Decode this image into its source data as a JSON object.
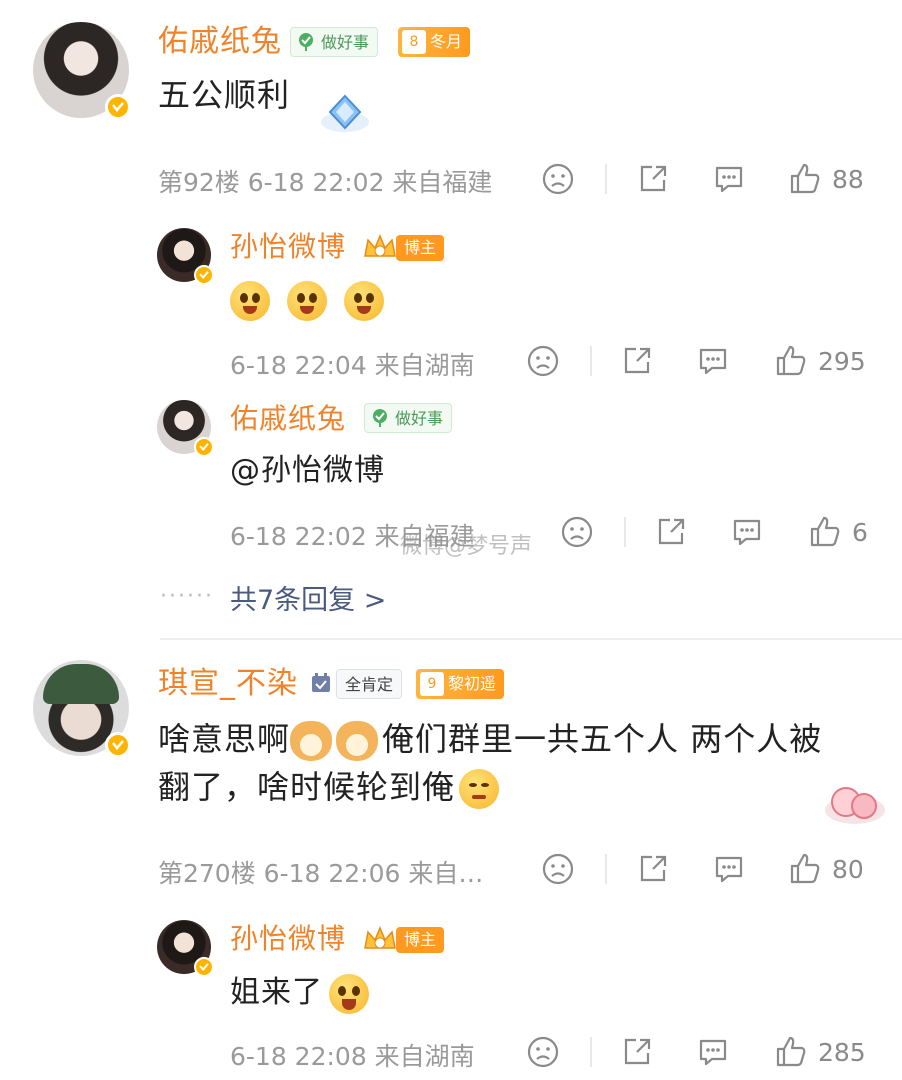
{
  "comments": [
    {
      "username": "佑戚纸兔",
      "badge_good": "做好事",
      "fan_level": "8",
      "fan_badge": "冬月",
      "text": "五公顺利",
      "meta": "第92楼  6-18 22:02  来自福建",
      "likes": "88",
      "replies": [
        {
          "username": "孙怡微博",
          "host_badge": "博主",
          "text_emojis": 3,
          "meta": "6-18 22:04  来自湖南",
          "likes": "295"
        },
        {
          "username": "佑戚纸兔",
          "badge_good": "做好事",
          "text": "@孙怡微博",
          "meta": "6-18 22:02  来自福建",
          "likes": "6"
        }
      ],
      "more_replies": "共7条回复 >"
    },
    {
      "username": "琪宣_不染",
      "cert_badge": "全肯定",
      "fan_level": "9",
      "fan_badge": "黎初遥",
      "text_line1_a": "啥意思啊",
      "text_line1_b": "俺们群里一共五个人 两个人被",
      "text_line2": "翻了，啥时候轮到俺",
      "meta": "第270楼  6-18 22:06  来自…",
      "likes": "80",
      "replies": [
        {
          "username": "孙怡微博",
          "host_badge": "博主",
          "text": "姐来了",
          "meta": "6-18 22:08  来自湖南",
          "likes": "285"
        }
      ]
    }
  ],
  "watermark": "微博@梦号声",
  "icons": [
    "dislike-icon",
    "share-icon",
    "comment-icon",
    "like-icon"
  ],
  "colors": {
    "username": "#f0832a",
    "more_link": "#4a5a80",
    "meta": "#9a9a9a"
  }
}
